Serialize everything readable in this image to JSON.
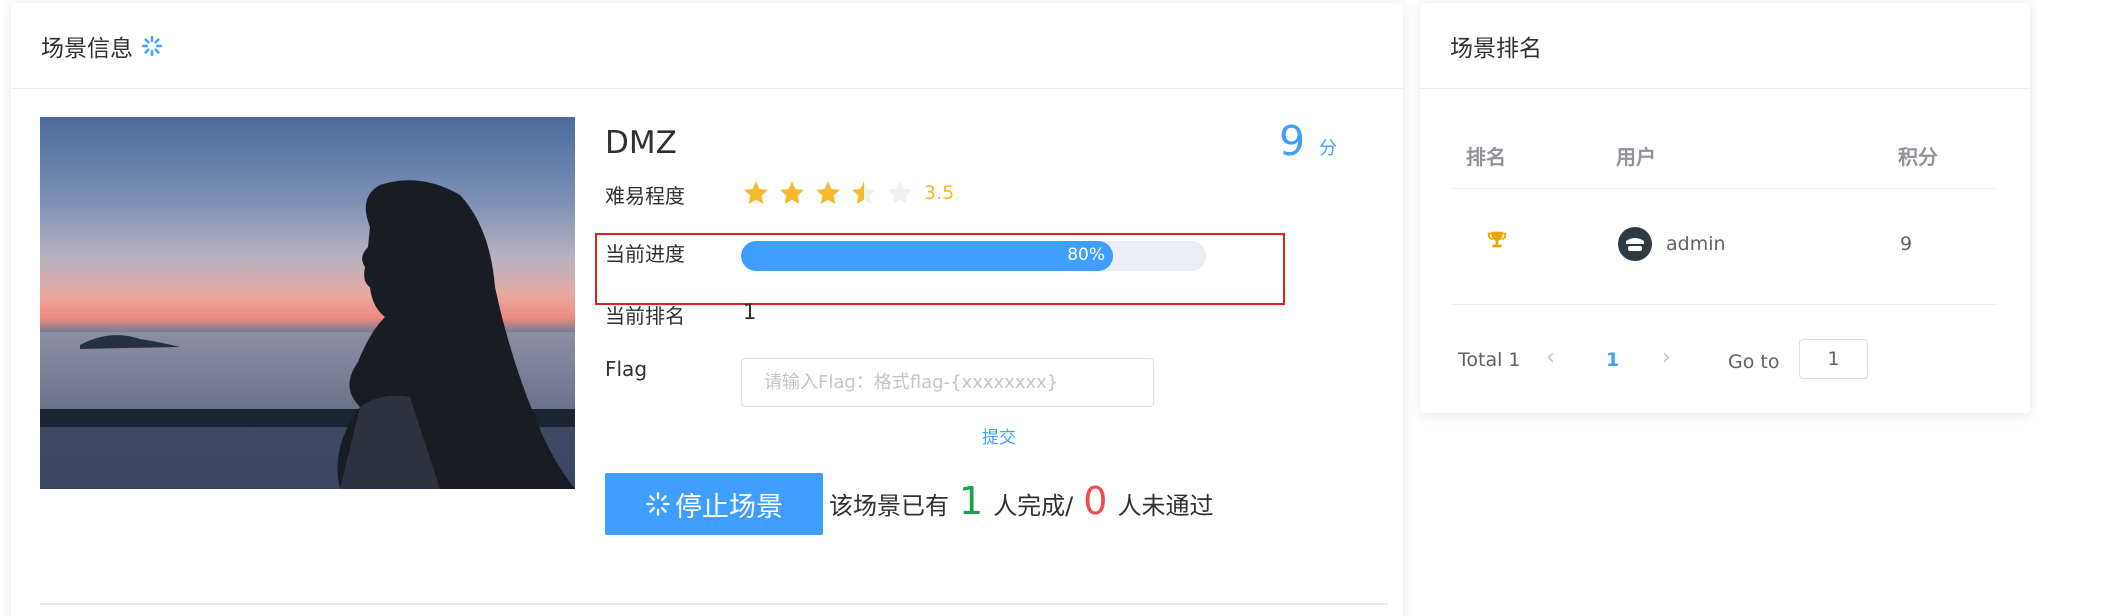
{
  "scene_panel": {
    "title": "场景信息",
    "scene_name": "DMZ",
    "score_value": "9",
    "score_unit": "分",
    "difficulty_label": "难易程度",
    "difficulty_rating": 3.5,
    "difficulty_text": "3.5",
    "difficulty_max": 5,
    "progress_label": "当前进度",
    "progress_percent": 80,
    "progress_text": "80%",
    "rank_label": "当前排名",
    "rank_value": "1",
    "flag_label": "Flag",
    "flag_placeholder": "请输入Flag：格式flag-{xxxxxxxx}",
    "flag_value": "",
    "submit_label": "提交",
    "stop_button_label": "停止场景",
    "summary_prefix": "该场景已有",
    "completed_count": "1",
    "summary_middle": "人完成/",
    "failed_count": "0",
    "summary_suffix": "人未通过"
  },
  "ranking_panel": {
    "title": "场景排名",
    "columns": [
      "排名",
      "用户",
      "积分"
    ],
    "rows": [
      {
        "rank_icon": "trophy-icon",
        "avatar_icon": "user-avatar-icon",
        "user": "admin",
        "score": "9"
      }
    ],
    "pagination": {
      "total_text": "Total 1",
      "current_page": "1",
      "goto_label": "Go to",
      "goto_value": "1"
    }
  },
  "colors": {
    "primary": "#409eff",
    "star": "#f7ba2a",
    "success": "#1aa34a",
    "danger": "#f04b4b",
    "highlight_border": "#e02020"
  }
}
